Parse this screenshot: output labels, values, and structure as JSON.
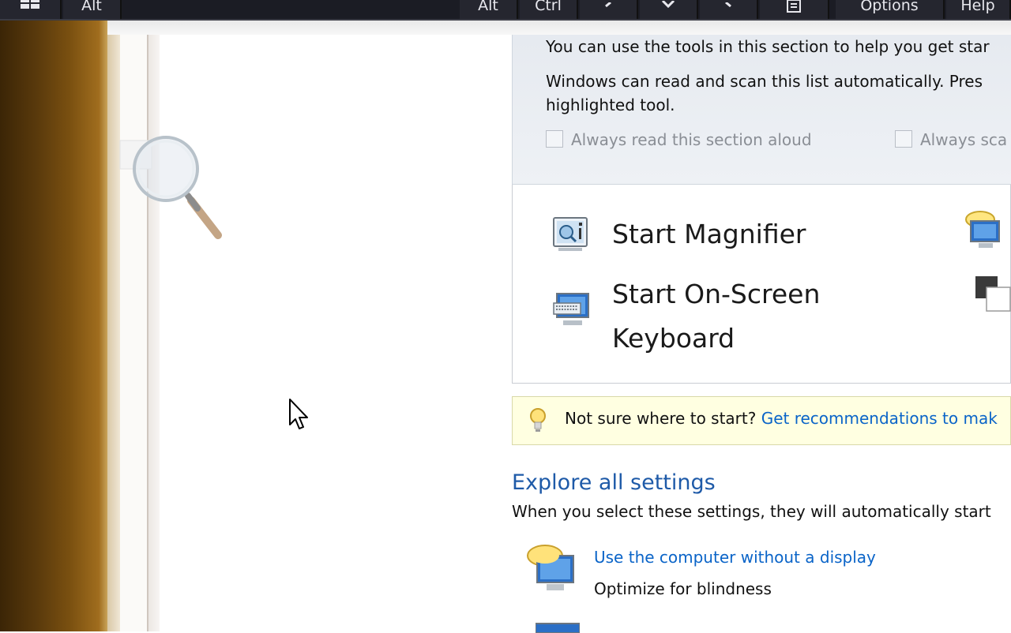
{
  "toolbar": {
    "windows_key": "windows-logo-icon",
    "alt_left": "Alt",
    "alt_right": "Alt",
    "ctrl": "Ctrl",
    "left_arrow": "<",
    "down_arrow": "v",
    "right_arrow": ">",
    "doc_icon": "document-icon",
    "options": "Options",
    "help": "Help"
  },
  "quick_access": {
    "intro": "You can use the tools in this section to help you get star",
    "scan_line1": "Windows can read and scan this list automatically.  Pres",
    "scan_line2": "highlighted tool.",
    "read_aloud_label": "Always read this section aloud",
    "scan_label": "Always sca",
    "read_aloud_checked": false,
    "scan_checked": false
  },
  "tools": {
    "magnifier": "Start Magnifier",
    "osk_line1": "Start On-Screen",
    "osk_line2": "Keyboard"
  },
  "tip": {
    "text": "Not sure where to start?",
    "link": "Get recommendations to mak"
  },
  "explore": {
    "title": "Explore all settings",
    "description": "When you select these settings, they will automatically start",
    "settings": [
      {
        "link": "Use the computer without a display",
        "subtitle": "Optimize for blindness"
      }
    ]
  },
  "colors": {
    "link": "#0a64c8",
    "heading": "#1e5aa8",
    "toolbar_bg": "#1b1c24",
    "tip_bg": "#ffffe1"
  }
}
